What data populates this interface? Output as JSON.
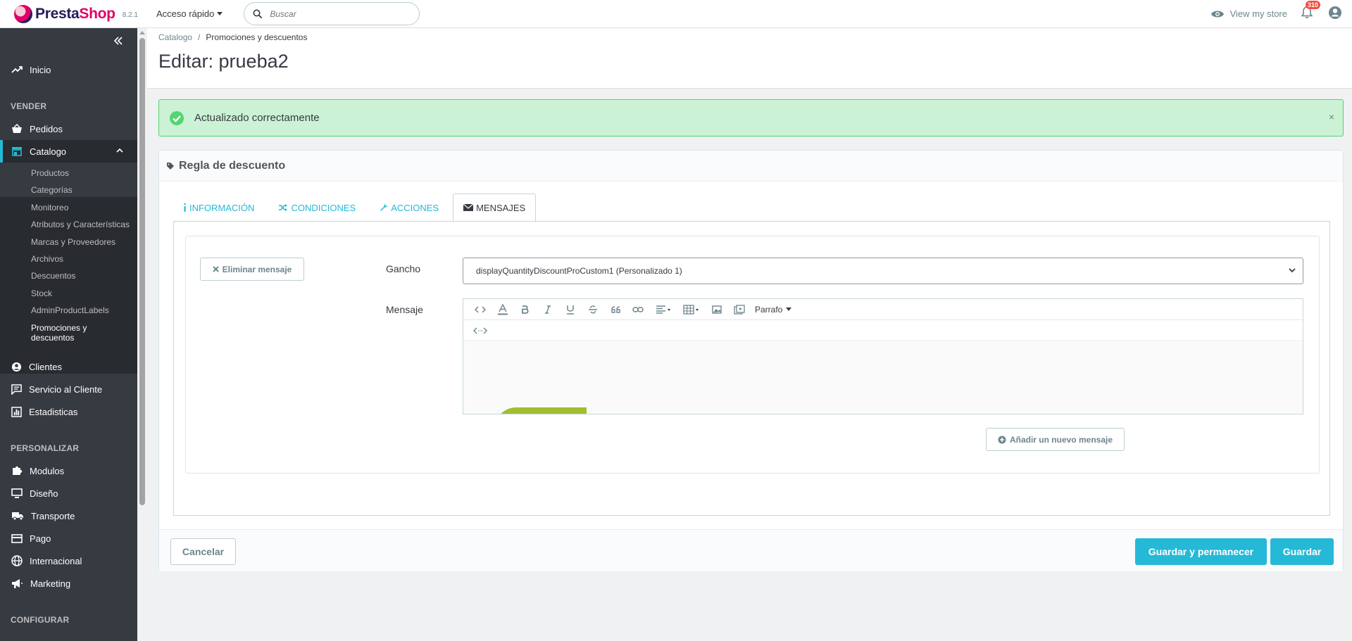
{
  "header": {
    "brand_presta": "Presta",
    "brand_shop": "Shop",
    "version": "8.2.1",
    "quick_access": "Acceso rápido",
    "search_placeholder": "Buscar",
    "view_store": "View my store",
    "notifications_count": "310"
  },
  "sidebar": {
    "home": "Inicio",
    "sections": {
      "sell": "VENDER",
      "customize": "PERSONALIZAR",
      "configure": "CONFIGURAR"
    },
    "sell_items": {
      "orders": "Pedidos",
      "catalog": "Catalogo",
      "customers": "Clientes",
      "customer_service": "Servicio al Cliente",
      "stats": "Estadisticas"
    },
    "catalog_sub": [
      "Productos",
      "Categorías",
      "Monitoreo",
      "Atributos y Características",
      "Marcas y Proveedores",
      "Archivos",
      "Descuentos",
      "Stock",
      "AdminProductLabels",
      "Promociones y descuentos"
    ],
    "customize_items": {
      "modules": "Modulos",
      "design": "Diseño",
      "shipping": "Transporte",
      "payment": "Pago",
      "international": "Internacional",
      "marketing": "Marketing"
    }
  },
  "page": {
    "breadcrumb": [
      "Catalogo",
      "Promociones y descuentos"
    ],
    "title": "Editar: prueba2"
  },
  "alert": {
    "message": "Actualizado correctamente",
    "close": "×"
  },
  "panel": {
    "heading": "Regla de descuento",
    "tabs": [
      "INFORMACIÓN",
      "CONDICIONES",
      "ACCIONES",
      "MENSAJES"
    ],
    "delete_message": "Eliminar mensaje",
    "hook_label": "Gancho",
    "hook_value": "displayQuantityDiscountProCustom1 (Personalizado 1)",
    "message_label": "Mensaje",
    "paragraph": "Parrafo",
    "add_message": "Añadir un nuevo mensaje",
    "cancel": "Cancelar",
    "save_stay": "Guardar y permanecer",
    "save": "Guardar"
  }
}
